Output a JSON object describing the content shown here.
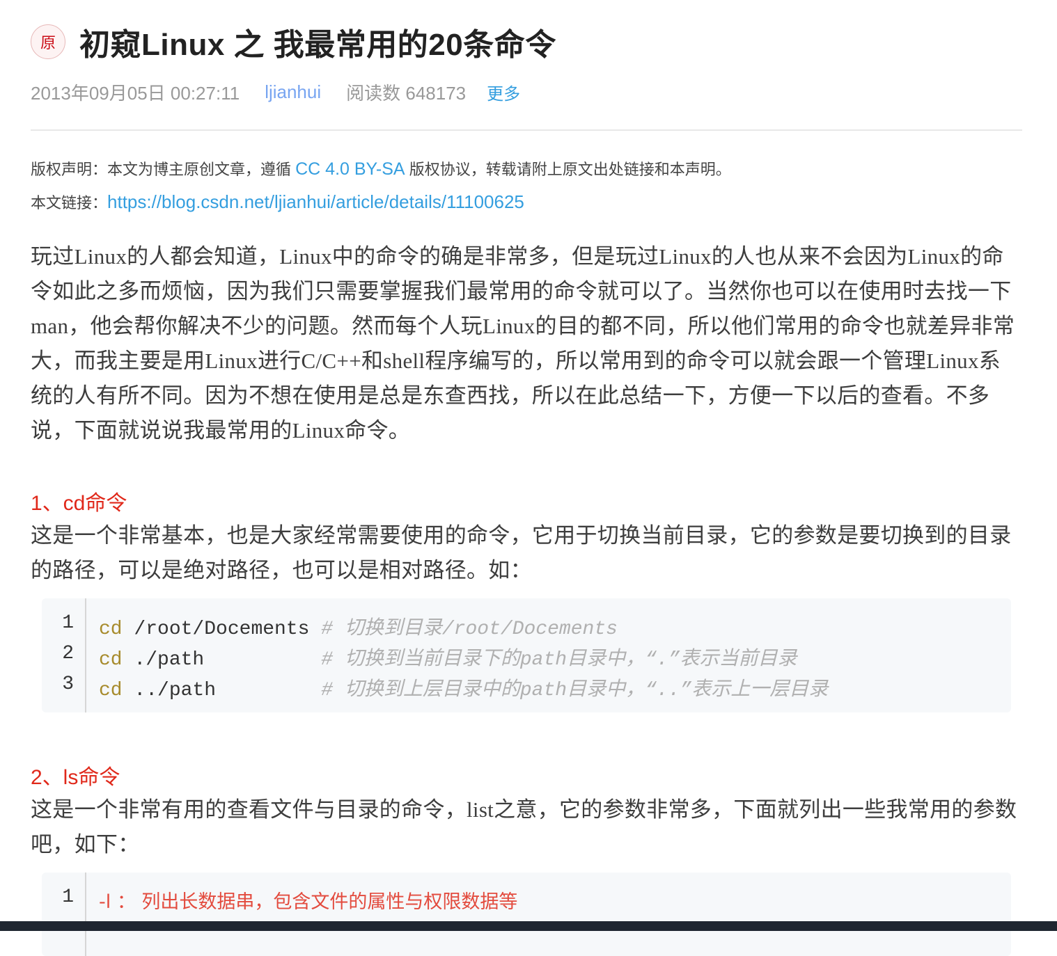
{
  "article": {
    "badge": "原",
    "title": "初窥Linux 之 我最常用的20条命令",
    "date": "2013年09月05日 00:27:11",
    "author": "ljianhui",
    "reads": "阅读数 648173",
    "more": "更多"
  },
  "copyright": {
    "prefix": "版权声明：本文为博主原创文章，遵循 ",
    "license": "CC 4.0 BY-SA",
    "suffix": " 版权协议，转载请附上原文出处链接和本声明。",
    "link_label": "本文链接：",
    "link_url": "https://blog.csdn.net/ljianhui/article/details/11100625"
  },
  "intro": "玩过Linux的人都会知道，Linux中的命令的确是非常多，但是玩过Linux的人也从来不会因为Linux的命令如此之多而烦恼，因为我们只需要掌握我们最常用的命令就可以了。当然你也可以在使用时去找一下man，他会帮你解决不少的问题。然而每个人玩Linux的目的都不同，所以他们常用的命令也就差异非常大，而我主要是用Linux进行C/C++和shell程序编写的，所以常用到的命令可以就会跟一个管理Linux系统的人有所不同。因为不想在使用是总是东查西找，所以在此总结一下，方便一下以后的查看。不多说，下面就说说我最常用的Linux命令。",
  "sections": [
    {
      "heading": "1、cd命令",
      "text": "这是一个非常基本，也是大家经常需要使用的命令，它用于切换当前目录，它的参数是要切换到的目录的路径，可以是绝对路径，也可以是相对路径。如：",
      "code": [
        {
          "num": "1",
          "kw": "cd",
          "arg": " /root/Docements ",
          "comment": "# 切换到目录/root/Docements"
        },
        {
          "num": "2",
          "kw": "cd",
          "arg": " ./path          ",
          "comment": "# 切换到当前目录下的path目录中，“.”表示当前目录"
        },
        {
          "num": "3",
          "kw": "cd",
          "arg": " ../path         ",
          "comment": "# 切换到上层目录中的path目录中，“..”表示上一层目录"
        }
      ]
    },
    {
      "heading": "2、ls命令",
      "text": "这是一个非常有用的查看文件与目录的命令，list之意，它的参数非常多，下面就列出一些我常用的参数吧，如下：",
      "code": [
        {
          "num": "1",
          "opt": "-l ： 列出长数据串，包含文件的属性与权限数据等"
        }
      ]
    }
  ]
}
